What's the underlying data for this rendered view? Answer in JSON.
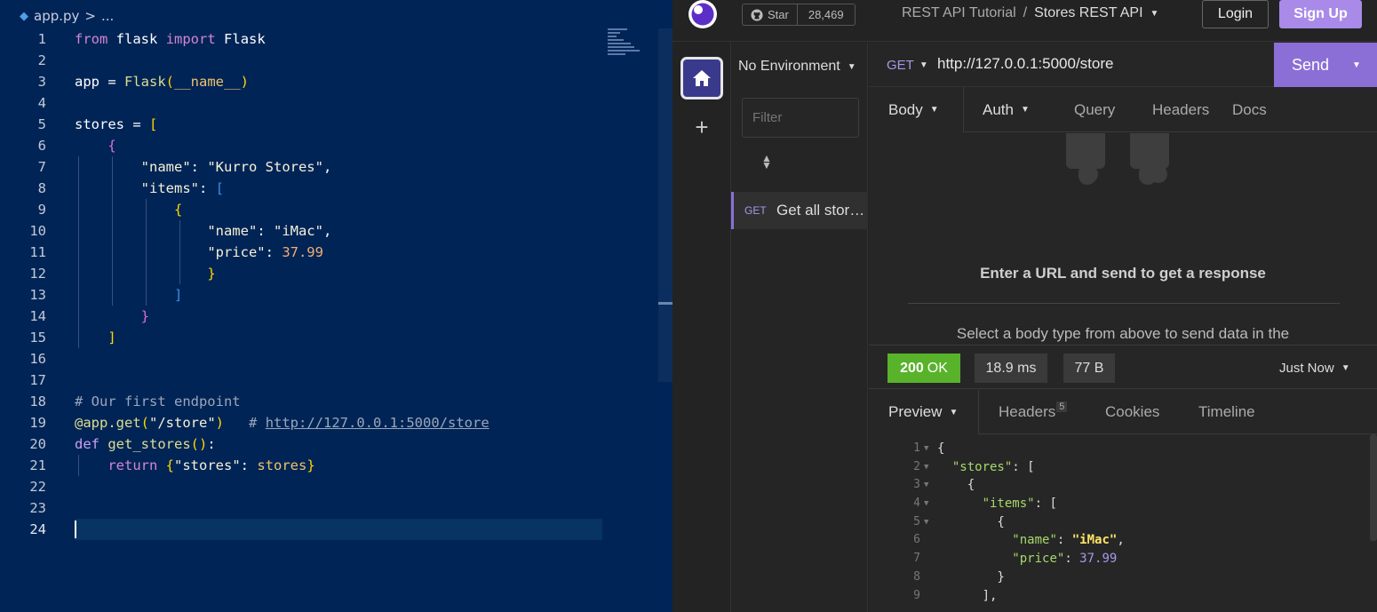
{
  "editor": {
    "breadcrumb_file": "app.py",
    "breadcrumb_sep": ">",
    "breadcrumb_more": "...",
    "lines": [
      {
        "n": "1"
      },
      {
        "n": "2"
      },
      {
        "n": "3"
      },
      {
        "n": "4"
      },
      {
        "n": "5"
      },
      {
        "n": "6"
      },
      {
        "n": "7"
      },
      {
        "n": "8"
      },
      {
        "n": "9"
      },
      {
        "n": "10"
      },
      {
        "n": "11"
      },
      {
        "n": "12"
      },
      {
        "n": "13"
      },
      {
        "n": "14"
      },
      {
        "n": "15"
      },
      {
        "n": "16"
      },
      {
        "n": "17"
      },
      {
        "n": "18"
      },
      {
        "n": "19"
      },
      {
        "n": "20"
      },
      {
        "n": "21"
      },
      {
        "n": "22"
      },
      {
        "n": "23"
      },
      {
        "n": "24"
      }
    ],
    "code": {
      "from": "from",
      "flask_mod": "flask",
      "import": "import",
      "flask_cls": "Flask",
      "app": "app",
      "eq": " = ",
      "flask_call": "Flask",
      "dunder": "__name__",
      "stores_var": "stores",
      "name_key": "\"name\"",
      "colon": ": ",
      "kurro": "\"Kurro Stores\"",
      "comma": ",",
      "items_key": "\"items\"",
      "name_key2": "\"name\"",
      "imac": "\"iMac\"",
      "price_key": "\"price\"",
      "price_val": "37.99",
      "comment": "# Our first endpoint",
      "deco_at": "@",
      "deco_app": "app",
      "deco_get": ".get",
      "route": "\"/store\"",
      "hash": "# ",
      "comment_url": "http://127.0.0.1:5000/store",
      "def": "def",
      "fn_name": "get_stores",
      "return": "return",
      "stores_key": "\"stores\"",
      "stores_ref": "stores"
    }
  },
  "insomnia": {
    "github_star": "Star",
    "github_count": "28,469",
    "project": "REST API Tutorial",
    "crumb_sep": "/",
    "collection": "Stores REST API",
    "login": "Login",
    "signup": "Sign Up",
    "environment": "No Environment",
    "filter_placeholder": "Filter",
    "request_method": "GET",
    "request_name": "Get all stores",
    "method": "GET",
    "url": "http://127.0.0.1:5000/store",
    "send": "Send",
    "request_tabs": {
      "body": "Body",
      "auth": "Auth",
      "query": "Query",
      "headers": "Headers",
      "docs": "Docs"
    },
    "empty_title": "Enter a URL and send to get a response",
    "empty_sub": "Select a body type from above to send data in the",
    "status_code": "200",
    "status_text": "OK",
    "time": "18.9 ms",
    "size": "77 B",
    "timestamp": "Just Now",
    "response_tabs": {
      "preview": "Preview",
      "headers": "Headers",
      "headers_count": "5",
      "cookies": "Cookies",
      "timeline": "Timeline"
    },
    "response": {
      "rows": [
        "1",
        "2",
        "3",
        "4",
        "5",
        "6",
        "7",
        "8",
        "9"
      ],
      "stores_key": "\"stores\"",
      "items_key": "\"items\"",
      "name_key": "\"name\"",
      "name_val": "\"iMac\"",
      "price_key": "\"price\"",
      "price_val": "37.99"
    }
  }
}
